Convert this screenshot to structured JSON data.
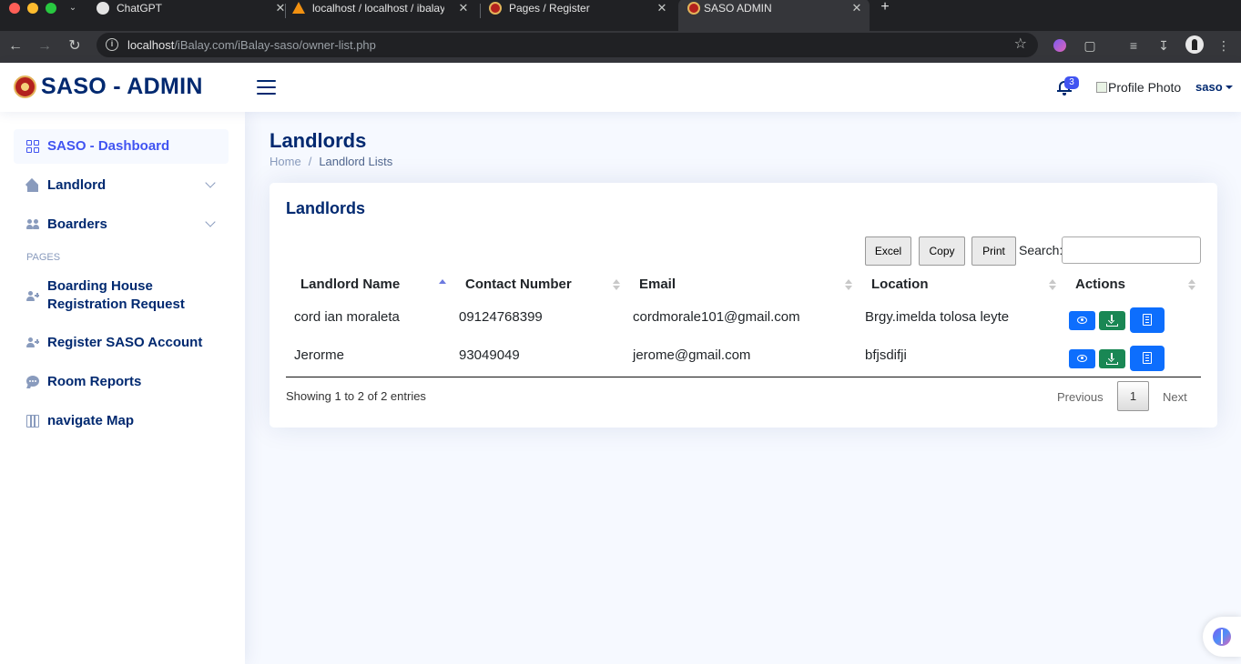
{
  "browser": {
    "tabs": [
      {
        "title": "ChatGPT",
        "icon": "chatgpt-icon",
        "active": false
      },
      {
        "title": "localhost / localhost / ibalay",
        "icon": "phpmyadmin-icon",
        "active": false
      },
      {
        "title": "Pages / Register",
        "icon": "saso-seal-icon",
        "active": false
      },
      {
        "title": "SASO ADMIN",
        "icon": "saso-seal-icon",
        "active": true
      }
    ],
    "new_tab": "+",
    "close": "✕",
    "url_host": "localhost",
    "url_path": "/iBalay.com/iBalay-saso/owner-list.php"
  },
  "header": {
    "brand": "SASO - ADMIN",
    "notification_count": "3",
    "profile_photo_alt": "Profile Photo",
    "profile_name": "saso"
  },
  "sidebar": {
    "items": [
      {
        "label": "SASO - Dashboard",
        "icon": "grid-icon"
      },
      {
        "label": "Landlord",
        "icon": "house-icon"
      },
      {
        "label": "Boarders",
        "icon": "people-icon"
      },
      {
        "label": "Boarding House Registration Request",
        "label_line1": "Boarding House",
        "label_line2": "Registration Request",
        "icon": "person-add-icon"
      },
      {
        "label": "Register SASO Account",
        "icon": "person-add-icon"
      },
      {
        "label": "Room Reports",
        "icon": "chat-icon"
      },
      {
        "label": "navigate Map",
        "icon": "map-icon"
      }
    ],
    "heading": "PAGES"
  },
  "main": {
    "page_title": "Landlords",
    "breadcrumb": {
      "home": "Home",
      "separator": "/",
      "current": "Landlord Lists"
    },
    "card_title": "Landlords",
    "buttons": {
      "excel": "Excel",
      "copy": "Copy",
      "print": "Print"
    },
    "search_label": "Search:",
    "search_value": "",
    "columns": [
      "Landlord Name",
      "Contact Number",
      "Email",
      "Location",
      "Actions"
    ],
    "rows": [
      {
        "name": "cord ian moraleta",
        "contact": "09124768399",
        "email": "cordmorale101@gmail.com",
        "location": "Brgy.imelda tolosa leyte"
      },
      {
        "name": "Jerorme",
        "contact": "93049049",
        "email": "jerome@gmail.com",
        "location": "bfjsdifji"
      }
    ],
    "info": "Showing 1 to 2 of 2 entries",
    "pagination": {
      "previous": "Previous",
      "page": "1",
      "next": "Next"
    }
  },
  "colors": {
    "brand": "#012970",
    "accent": "#4154f1",
    "view_button": "#0d6efd",
    "download_button": "#198754"
  }
}
